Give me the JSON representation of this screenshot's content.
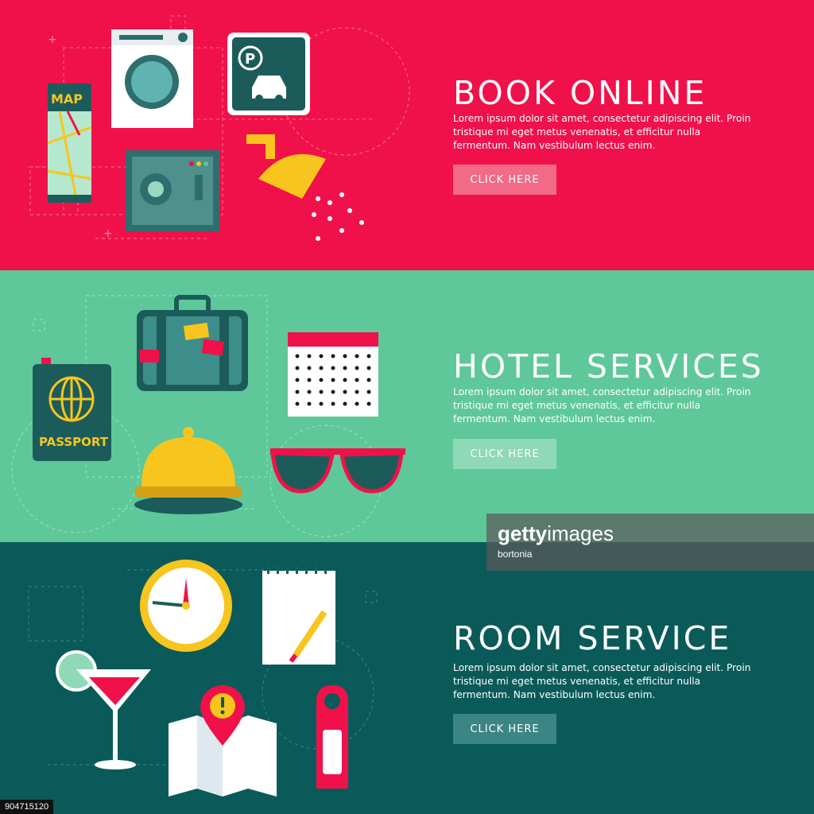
{
  "colors": {
    "book_bg": "#f0114a",
    "hotel_bg": "#5ec89a",
    "room_bg": "#0b5a5a",
    "accent_yellow": "#f7c51e",
    "accent_dark": "#1b5c5a"
  },
  "banners": [
    {
      "title": "BOOK ONLINE",
      "body": "Lorem ipsum dolor sit amet, consectetur adipiscing elit. Proin tristique mi eget metus venenatis, et efficitur nulla fermentum. Nam vestibulum lectus enim.",
      "button_label": "CLICK HERE",
      "icons": [
        "map-icon",
        "washing-machine-icon",
        "parking-sign-icon",
        "safe-icon",
        "shower-icon"
      ],
      "map_label": "MAP"
    },
    {
      "title": "HOTEL SERVICES",
      "body": "Lorem ipsum dolor sit amet, consectetur adipiscing elit. Proin tristique mi eget metus venenatis, et efficitur nulla fermentum. Nam vestibulum lectus enim.",
      "button_label": "CLICK HERE",
      "icons": [
        "passport-icon",
        "suitcase-icon",
        "calendar-icon",
        "service-bell-icon",
        "sunglasses-icon"
      ],
      "passport_label": "PASSPORT"
    },
    {
      "title": "ROOM SERVICE",
      "body": "Lorem ipsum dolor sit amet, consectetur adipiscing elit. Proin tristique mi eget metus venenatis, et efficitur nulla fermentum. Nam vestibulum lectus enim.",
      "button_label": "CLICK HERE",
      "icons": [
        "clock-icon",
        "notepad-icon",
        "cocktail-icon",
        "map-pin-icon",
        "door-hanger-icon"
      ]
    }
  ],
  "watermark": {
    "brand_bold": "getty",
    "brand_rest": "images",
    "credit": "bortonia"
  },
  "image_id": "904715120"
}
